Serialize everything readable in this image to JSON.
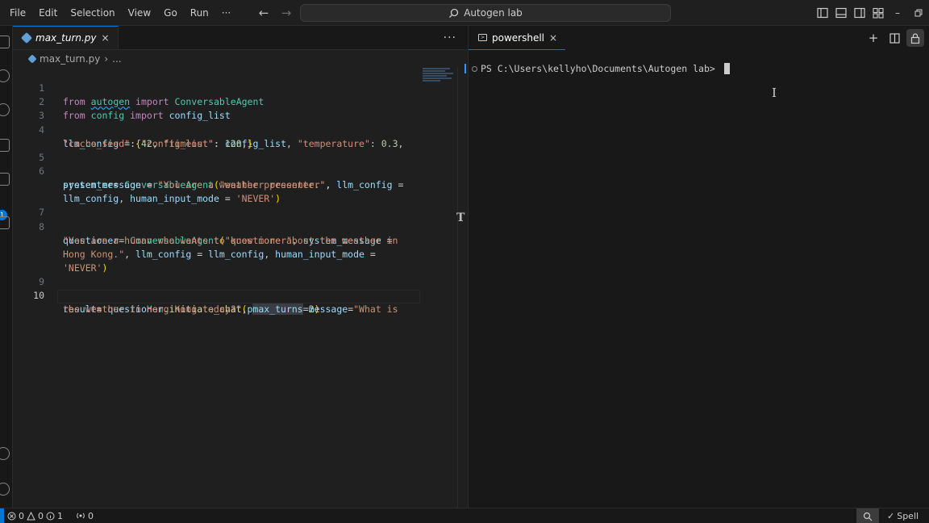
{
  "menu": [
    "File",
    "Edit",
    "Selection",
    "View",
    "Go",
    "Run",
    "···"
  ],
  "command_center": {
    "label": "Autogen lab"
  },
  "editor": {
    "tab": {
      "filename": "max_turn.py",
      "close": "×"
    },
    "tabs_more": "···",
    "breadcrumb": {
      "file": "max_turn.py",
      "sep": "›",
      "rest": "..."
    },
    "line_numbers": [
      "1",
      "2",
      "3",
      "4",
      "5",
      "6",
      "7",
      "8",
      "9",
      "10"
    ],
    "code": {
      "l1_from": "from",
      "l1_mod": "autogen",
      "l1_import": "import",
      "l1_cls": "ConversableAgent",
      "l2_from": "from",
      "l2_mod": "config",
      "l2_import": "import",
      "l2_name": "config_list",
      "l4_var": "llm_config",
      "l4_eq": " = ",
      "l4_brace": "{",
      "l4_k1": "\"config_list\"",
      "l4_c1": ": ",
      "l4_v1": "config_list",
      "l4_c2": ", ",
      "l4_k2": "\"temperature\"",
      "l4_c3": ": ",
      "l4_n1": "0.3",
      "l4_c4": ",",
      "l4b_k3": "\"cache_seed\"",
      "l4b_c1": ": ",
      "l4b_n2": "42",
      "l4b_c2": ", ",
      "l4b_k4": "\"timeout\"",
      "l4b_c3": ": ",
      "l4b_n3": "120",
      "l4b_c4": ",",
      "l4b_brace": "}",
      "l6_var": "presenter",
      "l6_eq": "= ",
      "l6_cls": "ConversableAgent",
      "l6_p": "(",
      "l6_s": "\"weather presenter\"",
      "l6_c": ",",
      "l6b_var": "system_message",
      "l6b_eq": " = ",
      "l6b_s": "\"You are a weather presenter.\"",
      "l6b_c": ", ",
      "l6b_var2": "llm_config",
      "l6b_eq2": " =",
      "l6c_var": "llm_config",
      "l6c_c": ", ",
      "l6c_var2": "human_input_mode",
      "l6c_eq": " = ",
      "l6c_s": "'NEVER'",
      "l6c_p": ")",
      "l8_var": "questioner",
      "l8_eq": "= ",
      "l8_cls": "ConversableAgent",
      "l8_p": "(",
      "l8_s": "\"questioner\"",
      "l8_c": ", ",
      "l8_var2": "system_message",
      "l8_eq2": " =",
      "l8b_s": "\"You are a human who wants to know more about the weather in",
      "l8c_s": "Hong Kong.\"",
      "l8c_c": ", ",
      "l8c_var": "llm_config",
      "l8c_eq": " = ",
      "l8c_var2": "llm_config",
      "l8c_c2": ", ",
      "l8c_var3": "human_input_mode",
      "l8c_eq2": " =",
      "l8d_s": "'NEVER'",
      "l8d_p": ")",
      "l10_var": "result",
      "l10_eq": "= ",
      "l10_obj": "questioner",
      "l10_dot": ".",
      "l10_fn": "initiate_chat",
      "l10_p": "(",
      "l10_var2": "presenter",
      "l10_c": ", ",
      "l10_var3": "message",
      "l10_eq2": "=",
      "l10_s": "\"What is",
      "l10b_s": "the weather in Hong Kong today?\"",
      "l10b_c": ", ",
      "l10b_var": "max_turns",
      "l10b_eq": "=",
      "l10b_n": "2",
      "l10b_p": ")"
    }
  },
  "terminal": {
    "tab": {
      "label": "powershell",
      "close": "×"
    },
    "prompt": "PS C:\\Users\\kellyho\\Documents\\Autogen lab> "
  },
  "status": {
    "errors": "0",
    "warnings": "0",
    "info": "1",
    "ports": "0",
    "spell": "Spell"
  },
  "colors": {
    "accent": "#0078d4",
    "keyword": "#c586c0",
    "class": "#4ec9b0",
    "string": "#ce9178",
    "number": "#b5cea8",
    "variable": "#9cdcfe"
  }
}
